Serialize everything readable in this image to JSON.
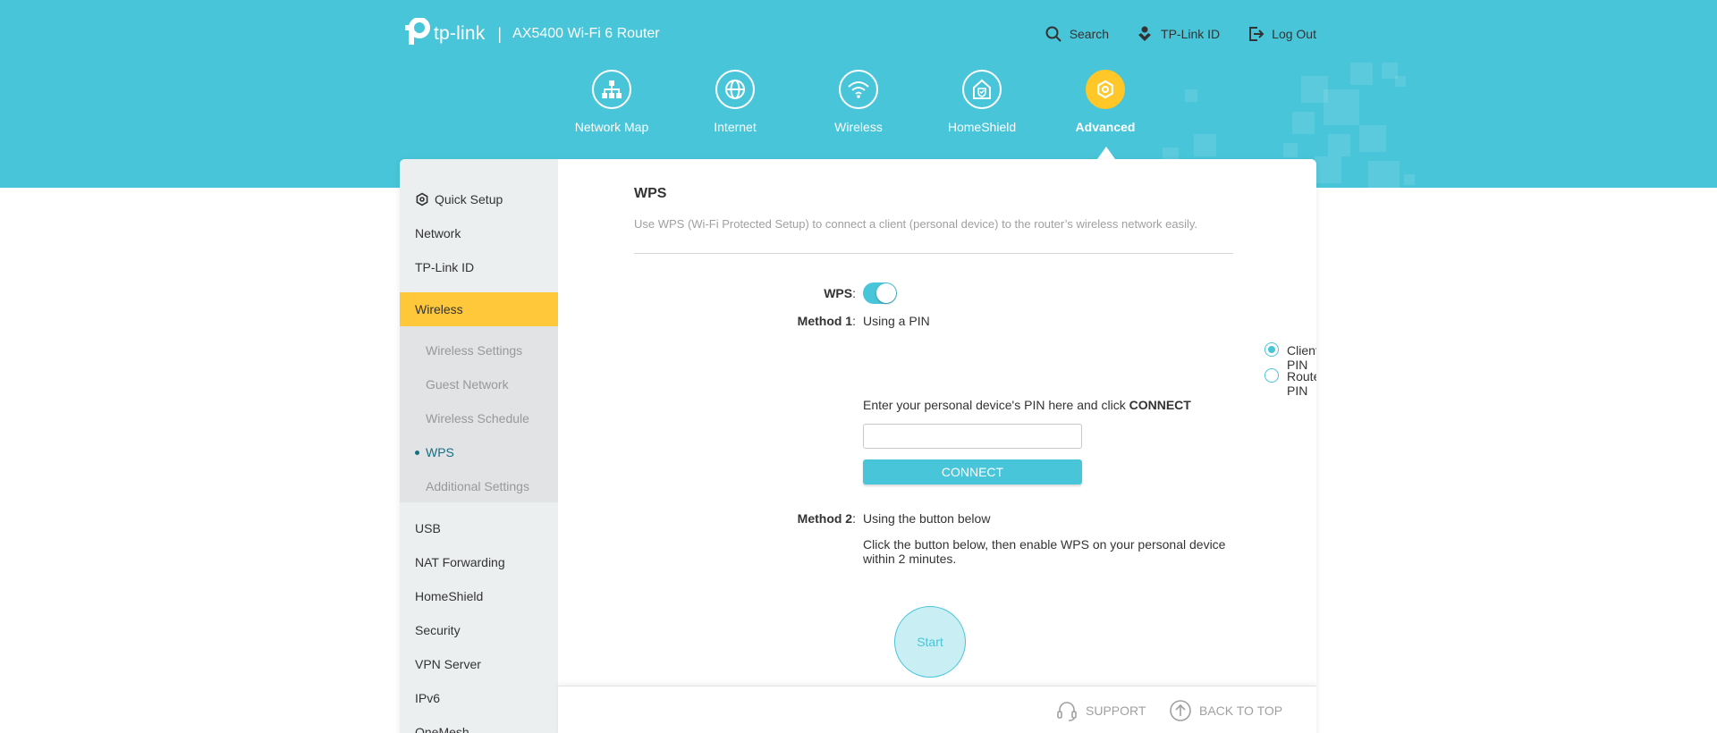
{
  "header": {
    "brand": "tp-link",
    "separator": "|",
    "model": "AX5400 Wi-Fi 6 Router",
    "search_label": "Search",
    "tplink_id_label": "TP-Link ID",
    "logout_label": "Log Out"
  },
  "nav": {
    "items": [
      {
        "label": "Network Map",
        "icon": "network-map-icon"
      },
      {
        "label": "Internet",
        "icon": "globe-icon"
      },
      {
        "label": "Wireless",
        "icon": "wifi-icon"
      },
      {
        "label": "HomeShield",
        "icon": "homeshield-icon"
      },
      {
        "label": "Advanced",
        "icon": "gear-icon",
        "active": true
      }
    ]
  },
  "sidebar": {
    "items": [
      {
        "label": "Quick Setup"
      },
      {
        "label": "Network"
      },
      {
        "label": "TP-Link ID"
      },
      {
        "label": "Wireless",
        "active": true
      },
      {
        "label": "USB"
      },
      {
        "label": "NAT Forwarding"
      },
      {
        "label": "HomeShield"
      },
      {
        "label": "Security"
      },
      {
        "label": "VPN Server"
      },
      {
        "label": "IPv6"
      },
      {
        "label": "OneMesh"
      }
    ],
    "subitems": [
      {
        "label": "Wireless Settings"
      },
      {
        "label": "Guest Network"
      },
      {
        "label": "Wireless Schedule"
      },
      {
        "label": "WPS",
        "active": true
      },
      {
        "label": "Additional Settings"
      }
    ]
  },
  "wps": {
    "title": "WPS",
    "description": "Use WPS (Wi-Fi Protected Setup) to connect a client (personal device) to the router’s wireless network easily.",
    "wps_label": "WPS",
    "wps_enabled": true,
    "colon": ":",
    "method1_label": "Method 1",
    "method1_text": "Using a PIN",
    "radio_client": "Client's PIN",
    "radio_router": "Router's PIN",
    "pin_instruction": "Enter your personal device's PIN here and click ",
    "pin_instruction_bold": "CONNECT",
    "pin_value": "",
    "connect_label": "CONNECT",
    "method2_label": "Method 2",
    "method2_text": "Using the button below",
    "method2_instruction": "Click the button below, then enable WPS on your personal device within 2 minutes.",
    "start_label": "Start"
  },
  "footer": {
    "support_label": "SUPPORT",
    "back_to_top_label": "BACK TO TOP"
  },
  "colors": {
    "accent": "#48c5d8",
    "active": "#ffc73a"
  }
}
